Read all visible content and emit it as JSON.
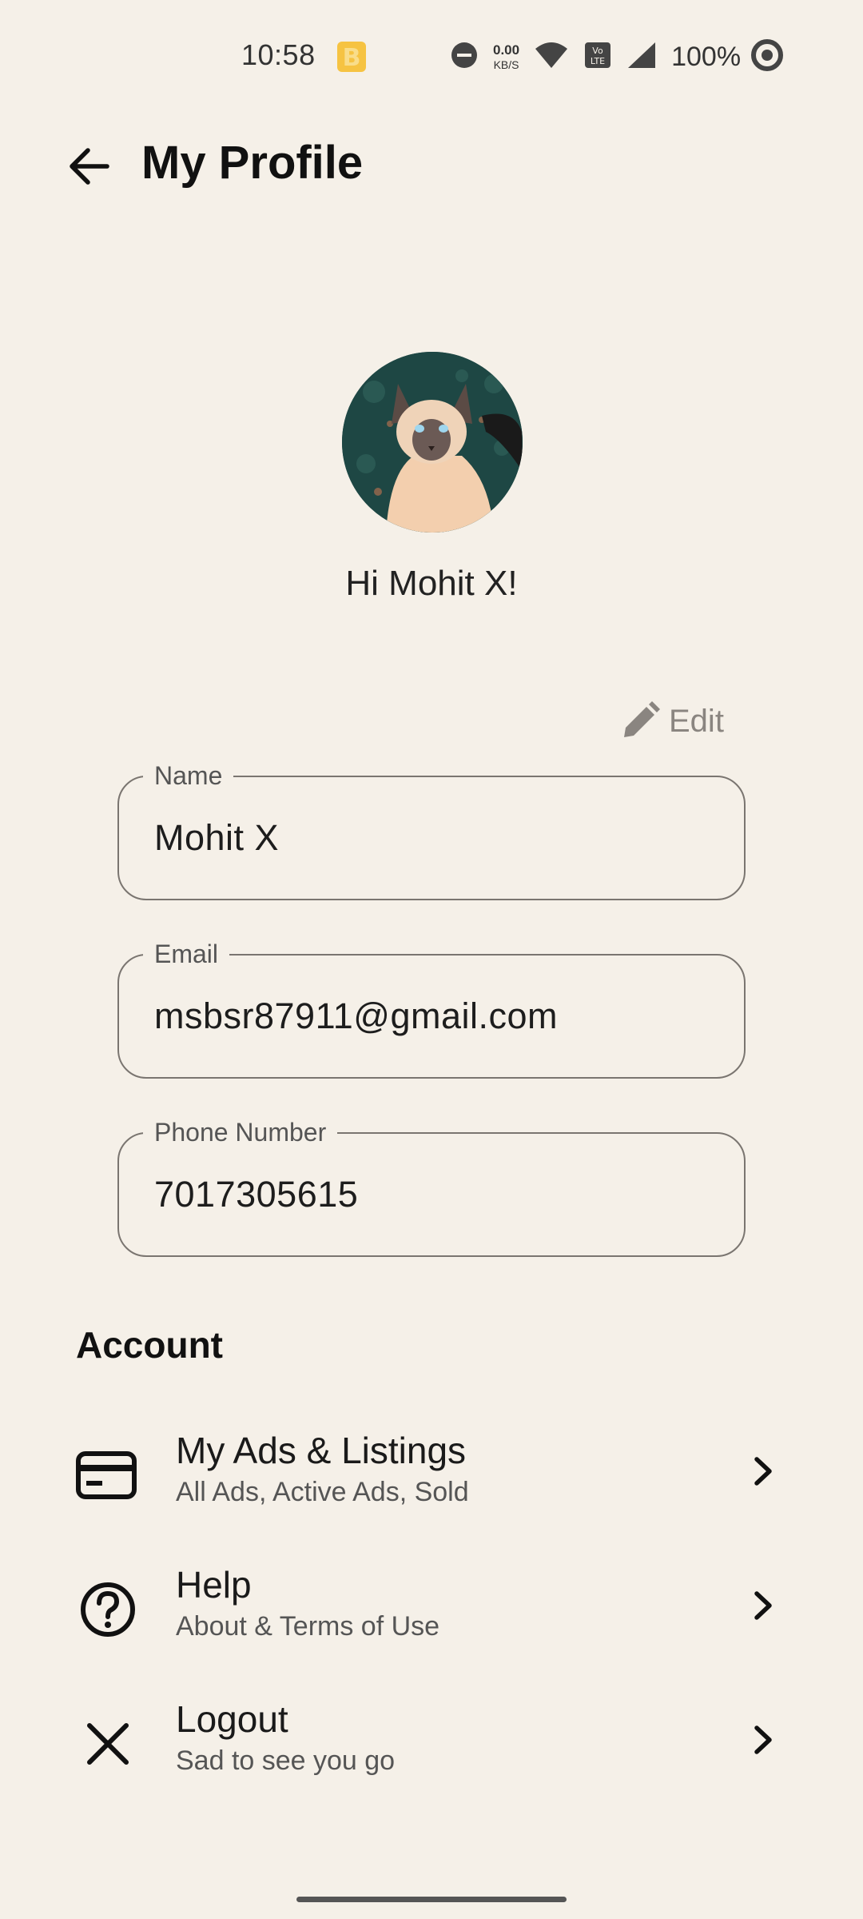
{
  "status_bar": {
    "time": "10:58",
    "speed_value": "0.00",
    "speed_unit": "KB/S",
    "battery": "100%",
    "icons": [
      "b-app-icon",
      "dnd-icon",
      "wifi-icon",
      "volte-icon",
      "signal-icon",
      "battery-ring-icon"
    ]
  },
  "header": {
    "title": "My Profile",
    "back_icon": "arrow-left-icon"
  },
  "profile": {
    "greeting": "Hi Mohit X!",
    "avatar": "siamese-cat-avatar"
  },
  "edit": {
    "label": "Edit",
    "icon": "pencil-icon"
  },
  "fields": {
    "name": {
      "label": "Name",
      "value": "Mohit X"
    },
    "email": {
      "label": "Email",
      "value": "msbsr87911@gmail.com"
    },
    "phone": {
      "label": "Phone Number",
      "value": "7017305615"
    }
  },
  "account": {
    "title": "Account",
    "items": [
      {
        "title": "My Ads & Listings",
        "subtitle": "All Ads, Active Ads, Sold",
        "icon": "card-icon"
      },
      {
        "title": "Help",
        "subtitle": "About & Terms of Use",
        "icon": "help-circle-icon"
      },
      {
        "title": "Logout",
        "subtitle": "Sad to see you go",
        "icon": "close-icon"
      }
    ]
  },
  "colors": {
    "background": "#f5f0e8",
    "text": "#111111",
    "muted": "#8a8580",
    "border": "#7a7570",
    "b_icon": "#f6c342"
  }
}
